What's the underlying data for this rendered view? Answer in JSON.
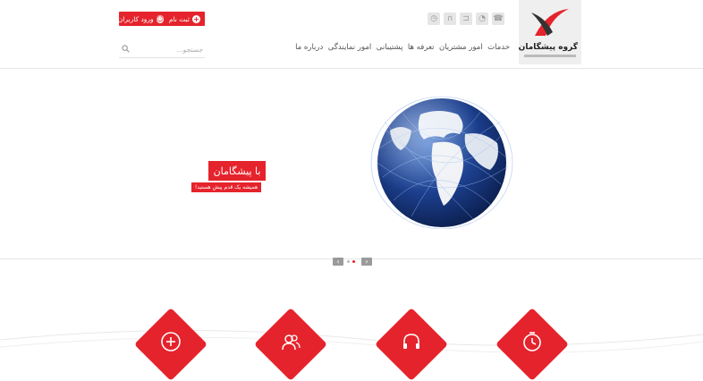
{
  "brand": {
    "logo_text": "گروه پیشگامان",
    "colors": {
      "accent": "#e5232c",
      "header_bg": "#ffffff",
      "logo_bg": "#efefef"
    }
  },
  "header": {
    "top_icons": [
      {
        "name": "history-icon",
        "glyph": "◷"
      },
      {
        "name": "headphones-icon",
        "glyph": "∩"
      },
      {
        "name": "cart-icon",
        "glyph": "⊐"
      },
      {
        "name": "rss-icon",
        "glyph": "◔"
      },
      {
        "name": "phone-icon",
        "glyph": "☎"
      }
    ],
    "register_label": "ثبت نام",
    "login_label": "ورود کاربران",
    "nav": [
      "خدمات",
      "امور مشتریان",
      "تعرفه ها",
      "پشتیبانی",
      "امور نمایندگی",
      "درباره ما"
    ],
    "search": {
      "placeholder": "جستجو..."
    }
  },
  "slider": {
    "caption_title": "با پیشگامان",
    "caption_subtitle": "همیشه یک قدم پیش هستید!",
    "slides_count": 2,
    "active_slide": 2,
    "prev_glyph": "‹",
    "next_glyph": "›"
  },
  "services": [
    {
      "name": "add-icon"
    },
    {
      "name": "users-icon"
    },
    {
      "name": "headset-icon"
    },
    {
      "name": "clock-icon"
    }
  ]
}
